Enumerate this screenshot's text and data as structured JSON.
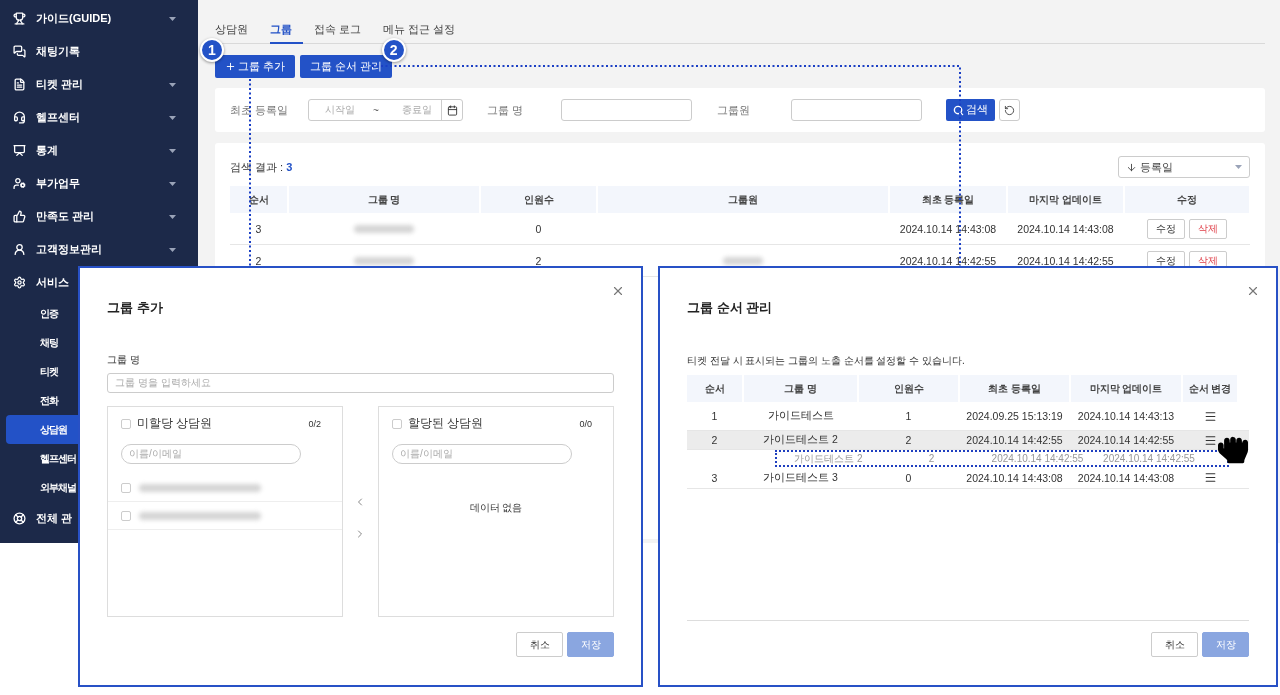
{
  "sidebar": {
    "items": [
      {
        "label": "가이드(GUIDE)",
        "expandable": true
      },
      {
        "label": "채팅기록",
        "expandable": false
      },
      {
        "label": "티켓 관리",
        "expandable": true
      },
      {
        "label": "헬프센터",
        "expandable": true
      },
      {
        "label": "통계",
        "expandable": true
      },
      {
        "label": "부가업무",
        "expandable": true
      },
      {
        "label": "만족도 관리",
        "expandable": true
      },
      {
        "label": "고객정보관리",
        "expandable": true
      },
      {
        "label": "서비스",
        "expandable": false,
        "children": [
          {
            "label": "인증",
            "selected": false
          },
          {
            "label": "채팅",
            "selected": false
          },
          {
            "label": "티켓",
            "selected": false
          },
          {
            "label": "전화",
            "selected": false
          },
          {
            "label": "상담원",
            "selected": true
          },
          {
            "label": "헬프센터",
            "selected": false
          },
          {
            "label": "외부채널",
            "selected": false
          }
        ]
      },
      {
        "label": "전체 관"
      }
    ]
  },
  "tabs": [
    {
      "label": "상담원",
      "selected": false
    },
    {
      "label": "그룹",
      "selected": true
    },
    {
      "label": "접속 로그",
      "selected": false
    },
    {
      "label": "메뉴 접근 설정",
      "selected": false
    }
  ],
  "toolbar": {
    "buttons": [
      {
        "label": "그룹 추가",
        "badge": "1",
        "plus": true
      },
      {
        "label": "그룹 순서 관리",
        "badge": "2",
        "plus": false
      }
    ]
  },
  "filter": {
    "date_label": "최초 등록일",
    "start_placeholder": "시작일",
    "separator": "~",
    "end_placeholder": "종료일",
    "name_label": "그룹 명",
    "member_label": "그룹원",
    "search_button": "검색"
  },
  "results": {
    "label": "검색 결과 : ",
    "count": "3",
    "sort": "등록일",
    "columns": [
      "순서",
      "그룹 명",
      "인원수",
      "그룹원",
      "최초 등록일",
      "마지막 업데이트",
      "수정"
    ],
    "rows": [
      {
        "order": "3",
        "name_redacted": true,
        "count": "0",
        "members_redacted": false,
        "created": "2024.10.14 14:43:08",
        "updated": "2024.10.14 14:43:08",
        "edit": "수정",
        "delete": "삭제"
      },
      {
        "order": "2",
        "name_redacted": true,
        "count": "2",
        "members_redacted": true,
        "created": "2024.10.14 14:42:55",
        "updated": "2024.10.14 14:42:55",
        "edit": "수정",
        "delete": "삭제"
      }
    ]
  },
  "add_dialog": {
    "title": "그룹 추가",
    "field_label": "그룹 명",
    "field_placeholder": "그룹 명을 입력하세요",
    "panels": [
      {
        "title": "미할당 상담원",
        "count": "0/2",
        "checked": false,
        "search_placeholder": "이름/이메일",
        "items": [
          {
            "redacted": true,
            "checked": false
          },
          {
            "redacted": true,
            "checked": false
          }
        ]
      },
      {
        "title": "할당된 상담원",
        "count": "0/0",
        "checked": false,
        "search_placeholder": "이름/이메일",
        "empty_text": "데이터 없음"
      }
    ],
    "buttons": [
      {
        "label": "취소",
        "disabled": false
      },
      {
        "label": "저장",
        "disabled": true
      }
    ]
  },
  "order_dialog": {
    "title": "그룹 순서 관리",
    "description": "티켓 전달 시 표시되는 그룹의 노출 순서를 설정할 수 있습니다.",
    "columns": [
      "순서",
      "그룹 명",
      "인원수",
      "최초 등록일",
      "마지막 업데이트",
      "순서 변경"
    ],
    "rows": [
      {
        "order": "1",
        "name": "가이드테스트",
        "count": "1",
        "created": "2024.09.25 15:13:19",
        "updated": "2024.10.14 14:43:13",
        "selected": false
      },
      {
        "order": "2",
        "name": "가이드테스트 2",
        "count": "2",
        "created": "2024.10.14 14:42:55",
        "updated": "2024.10.14 14:42:55",
        "selected": true
      },
      {
        "order": "3",
        "name": "가이드테스트 3",
        "count": "0",
        "created": "2024.10.14 14:43:08",
        "updated": "2024.10.14 14:43:08",
        "selected": false
      }
    ],
    "drag_ghost": {
      "name": "가이드테스트 2",
      "count": "2",
      "created": "2024.10.14 14:42:55",
      "updated": "2024.10.14 14:42:55"
    },
    "buttons": [
      {
        "label": "취소",
        "disabled": false
      },
      {
        "label": "저장",
        "disabled": true
      }
    ]
  }
}
